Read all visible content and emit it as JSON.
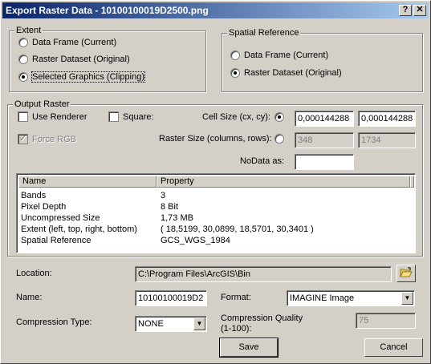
{
  "window": {
    "title": "Export Raster Data - 10100100019D2500.png",
    "help_glyph": "?",
    "close_glyph": "✕"
  },
  "extent": {
    "label": "Extent",
    "options": [
      {
        "label": "Data Frame (Current)",
        "selected": false
      },
      {
        "label": "Raster Dataset (Original)",
        "selected": false
      },
      {
        "label": "Selected Graphics (Clipping)",
        "selected": true
      }
    ]
  },
  "spatial_reference": {
    "label": "Spatial Reference",
    "options": [
      {
        "label": "Data Frame (Current)",
        "selected": false
      },
      {
        "label": "Raster Dataset (Original)",
        "selected": true
      }
    ]
  },
  "output_raster": {
    "label": "Output Raster",
    "use_renderer": "Use Renderer",
    "square": "Square:",
    "force_rgb": "Force RGB",
    "cell_size_label": "Cell Size (cx, cy):",
    "cell_cx": "0,000144288",
    "cell_cy": "0,000144288",
    "raster_size_label": "Raster Size (columns, rows):",
    "columns": "348",
    "rows": "1734",
    "nodata_label": "NoData as:",
    "nodata_value": ""
  },
  "properties": {
    "headers": [
      "Name",
      "Property"
    ],
    "rows": [
      [
        "Bands",
        "3"
      ],
      [
        "Pixel Depth",
        "8 Bit"
      ],
      [
        "Uncompressed Size",
        "1,73 MB"
      ],
      [
        "Extent (left, top, right, bottom)",
        "( 18,5199, 30,0899, 18,5701, 30,3401 )"
      ],
      [
        "Spatial Reference",
        "GCS_WGS_1984"
      ]
    ]
  },
  "location": {
    "label": "Location:",
    "value": "C:\\Program Files\\ArcGIS\\Bin"
  },
  "name": {
    "label": "Name:",
    "value": "10100100019D2"
  },
  "format": {
    "label": "Format:",
    "value": "IMAGINE Image"
  },
  "compression_type": {
    "label": "Compression Type:",
    "value": "NONE"
  },
  "compression_quality": {
    "label": "Compression Quality",
    "label2": "(1-100):",
    "value": "75"
  },
  "buttons": {
    "save": "Save",
    "cancel": "Cancel"
  },
  "icons": {
    "folder": "open-folder-icon",
    "dropdown": "▼"
  }
}
